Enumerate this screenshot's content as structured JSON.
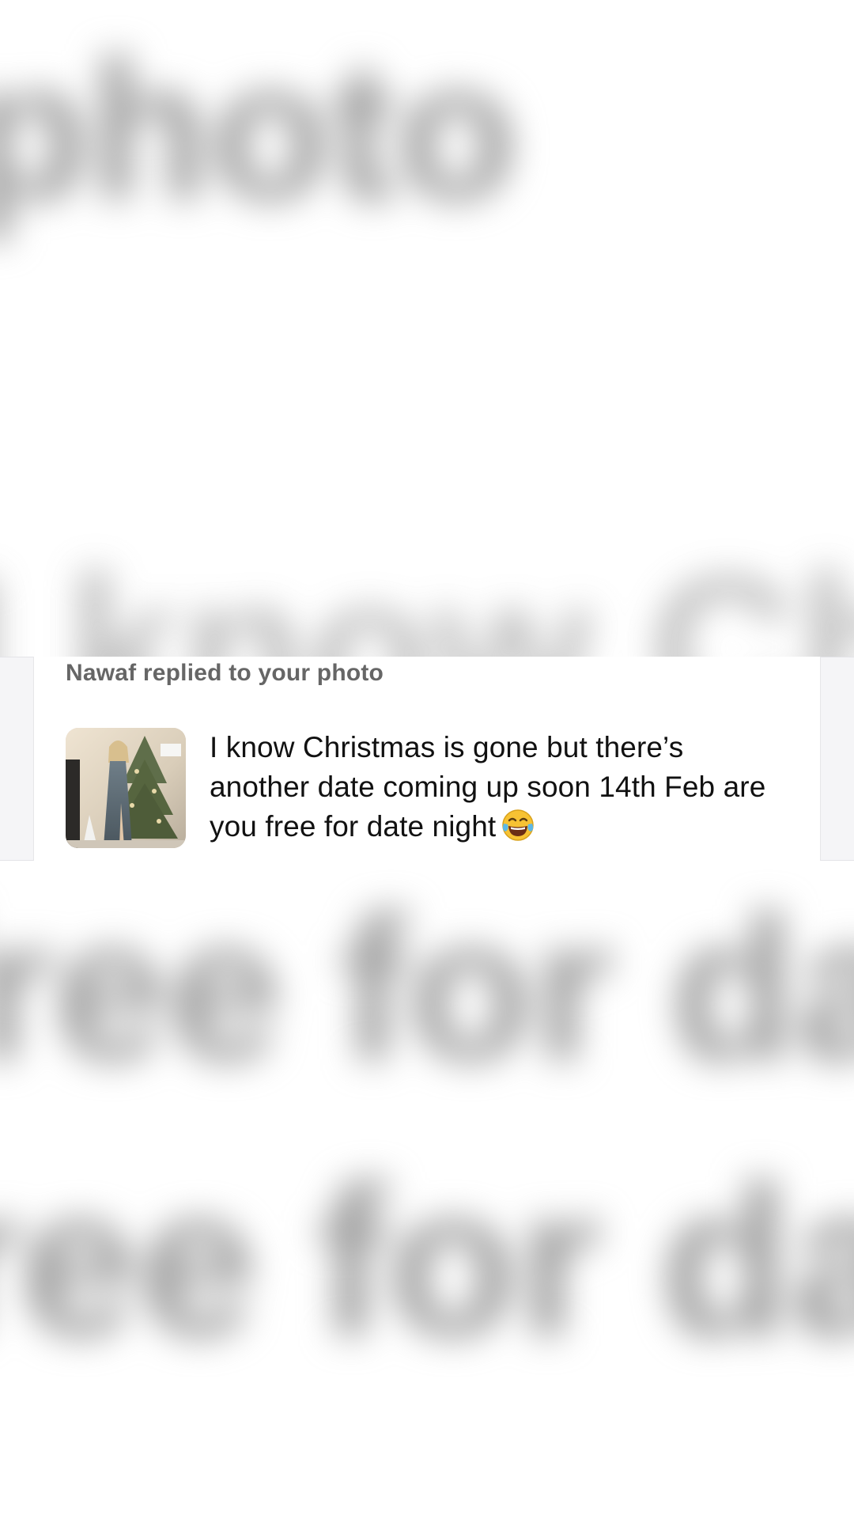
{
  "notification": {
    "header": "Nawaf replied to your photo",
    "message": "I know  Christmas is gone but there’s another date coming up soon 14th Feb are you free for date night",
    "emoji_icon": "face-with-tears-of-joy-icon",
    "thumbnail_icon": "photo-thumbnail-icon"
  },
  "colors": {
    "header_text": "#666666",
    "message_text": "#111111",
    "card_background": "#ffffff",
    "strip_background": "#f5f5f7"
  }
}
